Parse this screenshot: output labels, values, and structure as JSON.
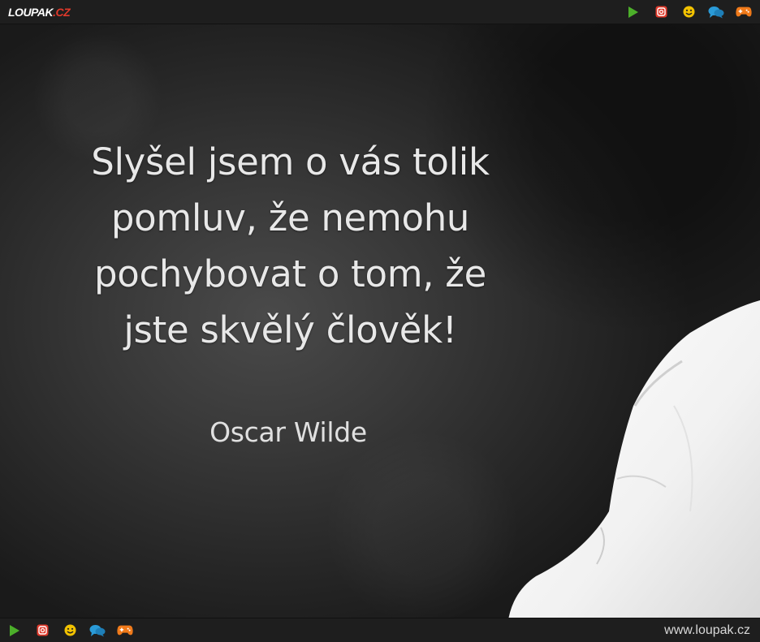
{
  "header": {
    "logo_main": "LOUPAK",
    "logo_tld": ".CZ"
  },
  "icons": {
    "items": [
      "play-icon",
      "instagram-icon",
      "smiley-icon",
      "chat-icon",
      "gamepad-icon"
    ],
    "colors": {
      "play": "#4caf2a",
      "instagram": "#e0392b",
      "smiley": "#f2c200",
      "chat": "#2a9bd8",
      "gamepad": "#f07a1a"
    }
  },
  "quote": {
    "line1": "Slyšel jsem o vás tolik",
    "line2": "pomluv, že nemohu",
    "line3": "pochybovat o tom, že",
    "line4": "jste skvělý člověk!",
    "author": "Oscar Wilde"
  },
  "footer": {
    "site_url": "www.loupak.cz"
  }
}
